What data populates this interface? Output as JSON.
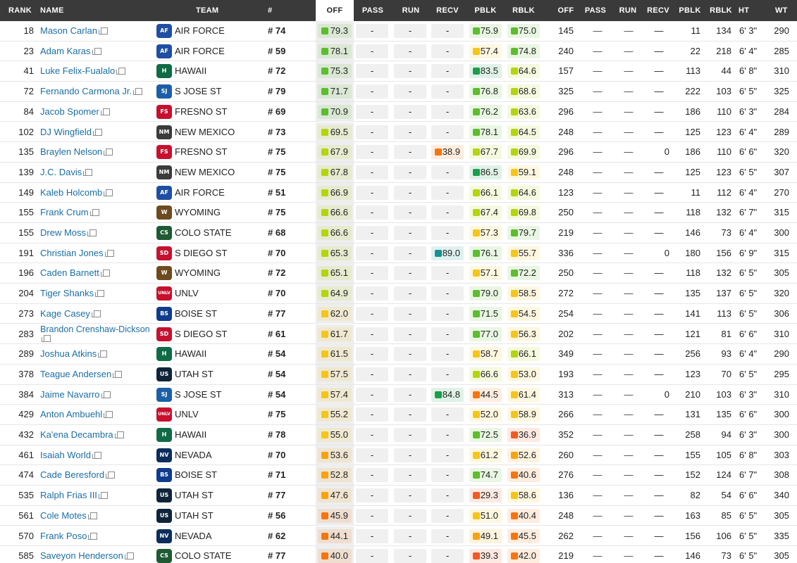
{
  "headers": {
    "rank": "RANK",
    "name": "NAME",
    "team": "TEAM",
    "jersey": "#",
    "off": "OFF",
    "pass": "PASS",
    "run": "RUN",
    "recv": "RECV",
    "pblk": "PBLK",
    "rblk": "RBLK",
    "snaps_off": "OFF",
    "snaps_pass": "PASS",
    "snaps_run": "RUN",
    "snaps_recv": "RECV",
    "snaps_pblk": "PBLK",
    "snaps_rblk": "RBLK",
    "ht": "HT",
    "wt": "WT"
  },
  "selected_sort_column": "OFF",
  "grade_colors": {
    "dark_green": "#1a9e4b",
    "green": "#5cbd2e",
    "lime": "#b5d40b",
    "yellow": "#f5c518",
    "amber": "#f7a20e",
    "orange": "#f5750f",
    "red_orange": "#f05a23",
    "teal": "#15928f"
  },
  "dash_text": "—",
  "grade_empty": "-",
  "team_logos": {
    "AIR FORCE": {
      "abbr": "AF",
      "color": "#1f4fa3"
    },
    "HAWAII": {
      "abbr": "H",
      "color": "#0f6b46"
    },
    "S JOSE ST": {
      "abbr": "SJ",
      "color": "#1b5fa8"
    },
    "FRESNO ST": {
      "abbr": "FS",
      "color": "#c8102e"
    },
    "NEW MEXICO": {
      "abbr": "NM",
      "color": "#3b3b3b"
    },
    "WYOMING": {
      "abbr": "W",
      "color": "#6e4a1f"
    },
    "COLO STATE": {
      "abbr": "CS",
      "color": "#1e5a32"
    },
    "S DIEGO ST": {
      "abbr": "SD",
      "color": "#c41230"
    },
    "UNLV": {
      "abbr": "UNLV",
      "color": "#c8102e"
    },
    "BOISE ST": {
      "abbr": "BS",
      "color": "#0d3b8e"
    },
    "UTAH ST": {
      "abbr": "US",
      "color": "#0f2439"
    },
    "NEVADA": {
      "abbr": "NV",
      "color": "#0b2d5c"
    }
  },
  "rows": [
    {
      "rank": "18",
      "name": "Mason Carlan",
      "team": "AIR FORCE",
      "jersey": "# 74",
      "off": "79.3",
      "offc": "green",
      "pass": "-",
      "run": "-",
      "recv": "-",
      "recvc": "",
      "pblk": "75.9",
      "pblkc": "green",
      "rblk": "75.0",
      "rblkc": "green",
      "s_off": "145",
      "s_pass": "—",
      "s_run": "—",
      "s_recv": "—",
      "s_pblk": "11",
      "s_rblk": "134",
      "ht": "6' 3\"",
      "wt": "290"
    },
    {
      "rank": "23",
      "name": "Adam Karas",
      "team": "AIR FORCE",
      "jersey": "# 59",
      "off": "78.1",
      "offc": "green",
      "pass": "-",
      "run": "-",
      "recv": "-",
      "recvc": "",
      "pblk": "57.4",
      "pblkc": "yellow",
      "rblk": "74.8",
      "rblkc": "green",
      "s_off": "240",
      "s_pass": "—",
      "s_run": "—",
      "s_recv": "—",
      "s_pblk": "22",
      "s_rblk": "218",
      "ht": "6' 4\"",
      "wt": "285"
    },
    {
      "rank": "41",
      "name": "Luke Felix-Fualalo",
      "team": "HAWAII",
      "jersey": "# 72",
      "off": "75.3",
      "offc": "green",
      "pass": "-",
      "run": "-",
      "recv": "-",
      "recvc": "",
      "pblk": "83.5",
      "pblkc": "dark_green",
      "rblk": "64.6",
      "rblkc": "lime",
      "s_off": "157",
      "s_pass": "—",
      "s_run": "—",
      "s_recv": "—",
      "s_pblk": "113",
      "s_rblk": "44",
      "ht": "6' 8\"",
      "wt": "310"
    },
    {
      "rank": "72",
      "name": "Fernando Carmona Jr.",
      "team": "S JOSE ST",
      "jersey": "# 79",
      "off": "71.7",
      "offc": "green",
      "pass": "-",
      "run": "-",
      "recv": "-",
      "recvc": "",
      "pblk": "76.8",
      "pblkc": "green",
      "rblk": "68.6",
      "rblkc": "lime",
      "s_off": "325",
      "s_pass": "—",
      "s_run": "—",
      "s_recv": "—",
      "s_pblk": "222",
      "s_rblk": "103",
      "ht": "6' 5\"",
      "wt": "325"
    },
    {
      "rank": "84",
      "name": "Jacob Spomer",
      "team": "FRESNO ST",
      "jersey": "# 69",
      "off": "70.9",
      "offc": "green",
      "pass": "-",
      "run": "-",
      "recv": "-",
      "recvc": "",
      "pblk": "76.2",
      "pblkc": "green",
      "rblk": "63.6",
      "rblkc": "lime",
      "s_off": "296",
      "s_pass": "—",
      "s_run": "—",
      "s_recv": "—",
      "s_pblk": "186",
      "s_rblk": "110",
      "ht": "6' 3\"",
      "wt": "284"
    },
    {
      "rank": "102",
      "name": "DJ Wingfield",
      "team": "NEW MEXICO",
      "jersey": "# 73",
      "off": "69.5",
      "offc": "lime",
      "pass": "-",
      "run": "-",
      "recv": "-",
      "recvc": "",
      "pblk": "78.1",
      "pblkc": "green",
      "rblk": "64.5",
      "rblkc": "lime",
      "s_off": "248",
      "s_pass": "—",
      "s_run": "—",
      "s_recv": "—",
      "s_pblk": "125",
      "s_rblk": "123",
      "ht": "6' 4\"",
      "wt": "289"
    },
    {
      "rank": "135",
      "name": "Braylen Nelson",
      "team": "FRESNO ST",
      "jersey": "# 75",
      "off": "67.9",
      "offc": "lime",
      "pass": "-",
      "run": "-",
      "recv": "38.9",
      "recvc": "orange",
      "pblk": "67.7",
      "pblkc": "lime",
      "rblk": "69.9",
      "rblkc": "lime",
      "s_off": "296",
      "s_pass": "—",
      "s_run": "—",
      "s_recv": "0",
      "s_pblk": "186",
      "s_rblk": "110",
      "ht": "6' 6\"",
      "wt": "320"
    },
    {
      "rank": "139",
      "name": "J.C. Davis",
      "team": "NEW MEXICO",
      "jersey": "# 75",
      "off": "67.8",
      "offc": "lime",
      "pass": "-",
      "run": "-",
      "recv": "-",
      "recvc": "",
      "pblk": "86.5",
      "pblkc": "dark_green",
      "rblk": "59.1",
      "rblkc": "yellow",
      "s_off": "248",
      "s_pass": "—",
      "s_run": "—",
      "s_recv": "—",
      "s_pblk": "125",
      "s_rblk": "123",
      "ht": "6' 5\"",
      "wt": "307"
    },
    {
      "rank": "149",
      "name": "Kaleb Holcomb",
      "team": "AIR FORCE",
      "jersey": "# 51",
      "off": "66.9",
      "offc": "lime",
      "pass": "-",
      "run": "-",
      "recv": "-",
      "recvc": "",
      "pblk": "66.1",
      "pblkc": "lime",
      "rblk": "64.6",
      "rblkc": "lime",
      "s_off": "123",
      "s_pass": "—",
      "s_run": "—",
      "s_recv": "—",
      "s_pblk": "11",
      "s_rblk": "112",
      "ht": "6' 4\"",
      "wt": "270"
    },
    {
      "rank": "155",
      "name": "Frank Crum",
      "team": "WYOMING",
      "jersey": "# 75",
      "off": "66.6",
      "offc": "lime",
      "pass": "-",
      "run": "-",
      "recv": "-",
      "recvc": "",
      "pblk": "67.4",
      "pblkc": "lime",
      "rblk": "69.8",
      "rblkc": "lime",
      "s_off": "250",
      "s_pass": "—",
      "s_run": "—",
      "s_recv": "—",
      "s_pblk": "118",
      "s_rblk": "132",
      "ht": "6' 7\"",
      "wt": "315"
    },
    {
      "rank": "155",
      "name": "Drew Moss",
      "team": "COLO STATE",
      "jersey": "# 68",
      "off": "66.6",
      "offc": "lime",
      "pass": "-",
      "run": "-",
      "recv": "-",
      "recvc": "",
      "pblk": "57.3",
      "pblkc": "yellow",
      "rblk": "79.7",
      "rblkc": "green",
      "s_off": "219",
      "s_pass": "—",
      "s_run": "—",
      "s_recv": "—",
      "s_pblk": "146",
      "s_rblk": "73",
      "ht": "6' 4\"",
      "wt": "300"
    },
    {
      "rank": "191",
      "name": "Christian Jones",
      "team": "S DIEGO ST",
      "jersey": "# 70",
      "off": "65.3",
      "offc": "lime",
      "pass": "-",
      "run": "-",
      "recv": "89.0",
      "recvc": "teal",
      "pblk": "76.1",
      "pblkc": "green",
      "rblk": "55.7",
      "rblkc": "yellow",
      "s_off": "336",
      "s_pass": "—",
      "s_run": "—",
      "s_recv": "0",
      "s_pblk": "180",
      "s_rblk": "156",
      "ht": "6' 9\"",
      "wt": "315"
    },
    {
      "rank": "196",
      "name": "Caden Barnett",
      "team": "WYOMING",
      "jersey": "# 72",
      "off": "65.1",
      "offc": "lime",
      "pass": "-",
      "run": "-",
      "recv": "-",
      "recvc": "",
      "pblk": "57.1",
      "pblkc": "yellow",
      "rblk": "72.2",
      "rblkc": "green",
      "s_off": "250",
      "s_pass": "—",
      "s_run": "—",
      "s_recv": "—",
      "s_pblk": "118",
      "s_rblk": "132",
      "ht": "6' 5\"",
      "wt": "305"
    },
    {
      "rank": "204",
      "name": "Tiger Shanks",
      "team": "UNLV",
      "jersey": "# 70",
      "off": "64.9",
      "offc": "lime",
      "pass": "-",
      "run": "-",
      "recv": "-",
      "recvc": "",
      "pblk": "79.0",
      "pblkc": "green",
      "rblk": "58.5",
      "rblkc": "yellow",
      "s_off": "272",
      "s_pass": "—",
      "s_run": "—",
      "s_recv": "—",
      "s_pblk": "135",
      "s_rblk": "137",
      "ht": "6' 5\"",
      "wt": "320"
    },
    {
      "rank": "273",
      "name": "Kage Casey",
      "team": "BOISE ST",
      "jersey": "# 77",
      "off": "62.0",
      "offc": "yellow",
      "pass": "-",
      "run": "-",
      "recv": "-",
      "recvc": "",
      "pblk": "71.5",
      "pblkc": "green",
      "rblk": "54.5",
      "rblkc": "yellow",
      "s_off": "254",
      "s_pass": "—",
      "s_run": "—",
      "s_recv": "—",
      "s_pblk": "141",
      "s_rblk": "113",
      "ht": "6' 5\"",
      "wt": "306"
    },
    {
      "rank": "283",
      "name": "Brandon Crenshaw-Dickson",
      "two": true,
      "team": "S DIEGO ST",
      "jersey": "# 61",
      "off": "61.7",
      "offc": "yellow",
      "pass": "-",
      "run": "-",
      "recv": "-",
      "recvc": "",
      "pblk": "77.0",
      "pblkc": "green",
      "rblk": "56.3",
      "rblkc": "yellow",
      "s_off": "202",
      "s_pass": "—",
      "s_run": "—",
      "s_recv": "—",
      "s_pblk": "121",
      "s_rblk": "81",
      "ht": "6' 6\"",
      "wt": "310"
    },
    {
      "rank": "289",
      "name": "Joshua Atkins",
      "team": "HAWAII",
      "jersey": "# 54",
      "off": "61.5",
      "offc": "yellow",
      "pass": "-",
      "run": "-",
      "recv": "-",
      "recvc": "",
      "pblk": "58.7",
      "pblkc": "yellow",
      "rblk": "66.1",
      "rblkc": "lime",
      "s_off": "349",
      "s_pass": "—",
      "s_run": "—",
      "s_recv": "—",
      "s_pblk": "256",
      "s_rblk": "93",
      "ht": "6' 4\"",
      "wt": "290"
    },
    {
      "rank": "378",
      "name": "Teague Andersen",
      "team": "UTAH ST",
      "jersey": "# 54",
      "off": "57.5",
      "offc": "yellow",
      "pass": "-",
      "run": "-",
      "recv": "-",
      "recvc": "",
      "pblk": "66.6",
      "pblkc": "lime",
      "rblk": "53.0",
      "rblkc": "yellow",
      "s_off": "193",
      "s_pass": "—",
      "s_run": "—",
      "s_recv": "—",
      "s_pblk": "123",
      "s_rblk": "70",
      "ht": "6' 5\"",
      "wt": "295"
    },
    {
      "rank": "384",
      "name": "Jaime Navarro",
      "team": "S JOSE ST",
      "jersey": "# 54",
      "off": "57.4",
      "offc": "yellow",
      "pass": "-",
      "run": "-",
      "recv": "84.8",
      "recvc": "dark_green",
      "pblk": "44.5",
      "pblkc": "orange",
      "rblk": "61.4",
      "rblkc": "yellow",
      "s_off": "313",
      "s_pass": "—",
      "s_run": "—",
      "s_recv": "0",
      "s_pblk": "210",
      "s_rblk": "103",
      "ht": "6' 3\"",
      "wt": "310"
    },
    {
      "rank": "429",
      "name": "Anton Ambuehl",
      "team": "UNLV",
      "jersey": "# 75",
      "off": "55.2",
      "offc": "yellow",
      "pass": "-",
      "run": "-",
      "recv": "-",
      "recvc": "",
      "pblk": "52.0",
      "pblkc": "yellow",
      "rblk": "58.9",
      "rblkc": "yellow",
      "s_off": "266",
      "s_pass": "—",
      "s_run": "—",
      "s_recv": "—",
      "s_pblk": "131",
      "s_rblk": "135",
      "ht": "6' 6\"",
      "wt": "300"
    },
    {
      "rank": "432",
      "name": "Ka'ena Decambra",
      "team": "HAWAII",
      "jersey": "# 78",
      "off": "55.0",
      "offc": "yellow",
      "pass": "-",
      "run": "-",
      "recv": "-",
      "recvc": "",
      "pblk": "72.5",
      "pblkc": "green",
      "rblk": "36.9",
      "rblkc": "red_orange",
      "s_off": "352",
      "s_pass": "—",
      "s_run": "—",
      "s_recv": "—",
      "s_pblk": "258",
      "s_rblk": "94",
      "ht": "6' 3\"",
      "wt": "300"
    },
    {
      "rank": "461",
      "name": "Isaiah World",
      "team": "NEVADA",
      "jersey": "# 70",
      "off": "53.6",
      "offc": "amber",
      "pass": "-",
      "run": "-",
      "recv": "-",
      "recvc": "",
      "pblk": "61.2",
      "pblkc": "yellow",
      "rblk": "52.6",
      "rblkc": "amber",
      "s_off": "260",
      "s_pass": "—",
      "s_run": "—",
      "s_recv": "—",
      "s_pblk": "155",
      "s_rblk": "105",
      "ht": "6' 8\"",
      "wt": "303"
    },
    {
      "rank": "474",
      "name": "Cade Beresford",
      "team": "BOISE ST",
      "jersey": "# 71",
      "off": "52.8",
      "offc": "amber",
      "pass": "-",
      "run": "-",
      "recv": "-",
      "recvc": "",
      "pblk": "74.7",
      "pblkc": "green",
      "rblk": "40.6",
      "rblkc": "orange",
      "s_off": "276",
      "s_pass": "—",
      "s_run": "—",
      "s_recv": "—",
      "s_pblk": "152",
      "s_rblk": "124",
      "ht": "6' 7\"",
      "wt": "308"
    },
    {
      "rank": "535",
      "name": "Ralph Frias III",
      "team": "UTAH ST",
      "jersey": "# 77",
      "off": "47.6",
      "offc": "amber",
      "pass": "-",
      "run": "-",
      "recv": "-",
      "recvc": "",
      "pblk": "29.3",
      "pblkc": "red_orange",
      "rblk": "58.6",
      "rblkc": "yellow",
      "s_off": "136",
      "s_pass": "—",
      "s_run": "—",
      "s_recv": "—",
      "s_pblk": "82",
      "s_rblk": "54",
      "ht": "6' 6\"",
      "wt": "340"
    },
    {
      "rank": "561",
      "name": "Cole Motes",
      "team": "UTAH ST",
      "jersey": "# 56",
      "off": "45.9",
      "offc": "orange",
      "pass": "-",
      "run": "-",
      "recv": "-",
      "recvc": "",
      "pblk": "51.0",
      "pblkc": "yellow",
      "rblk": "40.4",
      "rblkc": "orange",
      "s_off": "248",
      "s_pass": "—",
      "s_run": "—",
      "s_recv": "—",
      "s_pblk": "163",
      "s_rblk": "85",
      "ht": "6' 5\"",
      "wt": "305"
    },
    {
      "rank": "570",
      "name": "Frank Poso",
      "team": "NEVADA",
      "jersey": "# 62",
      "off": "44.1",
      "offc": "orange",
      "pass": "-",
      "run": "-",
      "recv": "-",
      "recvc": "",
      "pblk": "49.1",
      "pblkc": "amber",
      "rblk": "45.5",
      "rblkc": "orange",
      "s_off": "262",
      "s_pass": "—",
      "s_run": "—",
      "s_recv": "—",
      "s_pblk": "156",
      "s_rblk": "106",
      "ht": "6' 5\"",
      "wt": "335"
    },
    {
      "rank": "585",
      "name": "Saveyon Henderson",
      "team": "COLO STATE",
      "jersey": "# 77",
      "off": "40.0",
      "offc": "orange",
      "pass": "-",
      "run": "-",
      "recv": "-",
      "recvc": "",
      "pblk": "39.3",
      "pblkc": "red_orange",
      "rblk": "42.0",
      "rblkc": "orange",
      "s_off": "219",
      "s_pass": "—",
      "s_run": "—",
      "s_recv": "—",
      "s_pblk": "146",
      "s_rblk": "73",
      "ht": "6' 5\"",
      "wt": "305"
    }
  ]
}
